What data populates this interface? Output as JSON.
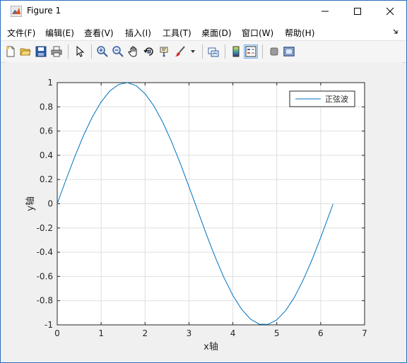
{
  "window": {
    "title": "Figure 1"
  },
  "menu": [
    "文件(F)",
    "编辑(E)",
    "查看(V)",
    "插入(I)",
    "工具(T)",
    "桌面(D)",
    "窗口(W)",
    "帮助(H)"
  ],
  "toolbar": {
    "items": [
      "new-figure-icon",
      "open-file-icon",
      "save-icon",
      "print-icon",
      "pointer-icon",
      "zoom-in-icon",
      "zoom-out-icon",
      "pan-icon",
      "rotate-3d-icon",
      "data-cursor-icon",
      "brush-icon",
      "link-plot-icon",
      "colorbar-icon",
      "legend-icon",
      "hide-plot-tools-icon",
      "show-plot-tools-icon"
    ]
  },
  "chart_data": {
    "type": "line",
    "xlabel": "x轴",
    "ylabel": "y轴",
    "xlim": [
      0,
      7
    ],
    "ylim": [
      -1,
      1
    ],
    "xticks": [
      0,
      1,
      2,
      3,
      4,
      5,
      6,
      7
    ],
    "yticks": [
      -1,
      -0.8,
      -0.6,
      -0.4,
      -0.2,
      0,
      0.2,
      0.4,
      0.6,
      0.8,
      1
    ],
    "grid": true,
    "legend_position": "top-right",
    "series": [
      {
        "name": "正弦波",
        "color": "#0072bd",
        "x": [
          0,
          0.2,
          0.4,
          0.6,
          0.8,
          1.0,
          1.2,
          1.4,
          1.6,
          1.8,
          2.0,
          2.2,
          2.4,
          2.6,
          2.8,
          3.0,
          3.2,
          3.4,
          3.6,
          3.8,
          4.0,
          4.2,
          4.4,
          4.6,
          4.8,
          5.0,
          5.2,
          5.4,
          5.6,
          5.8,
          6.0,
          6.2,
          6.28
        ],
        "y": [
          0,
          0.199,
          0.389,
          0.565,
          0.717,
          0.841,
          0.932,
          0.985,
          1.0,
          0.974,
          0.909,
          0.808,
          0.675,
          0.516,
          0.335,
          0.141,
          -0.058,
          -0.256,
          -0.443,
          -0.612,
          -0.757,
          -0.872,
          -0.952,
          -0.994,
          -0.996,
          -0.959,
          -0.883,
          -0.773,
          -0.631,
          -0.465,
          -0.279,
          -0.083,
          -0.003
        ]
      }
    ]
  }
}
